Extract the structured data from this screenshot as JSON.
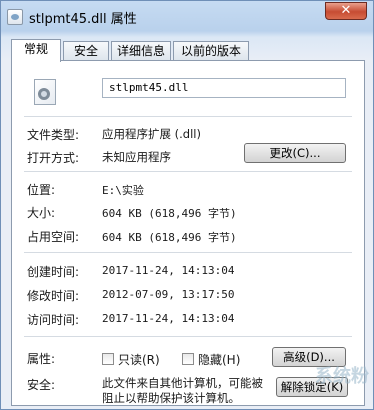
{
  "window": {
    "title": "stlpmt45.dll 属性",
    "close_glyph": "✕"
  },
  "tabs": [
    {
      "label": "常规",
      "active": true
    },
    {
      "label": "安全",
      "active": false
    },
    {
      "label": "详细信息",
      "active": false
    },
    {
      "label": "以前的版本",
      "active": false
    }
  ],
  "general": {
    "file_name": "stlpmt45.dll",
    "file_type_label": "文件类型:",
    "file_type_value": "应用程序扩展 (.dll)",
    "opens_with_label": "打开方式:",
    "opens_with_value": "未知应用程序",
    "change_button": "更改(C)...",
    "location_label": "位置:",
    "location_value": "E:\\实验",
    "size_label": "大小:",
    "size_value": "604 KB (618,496 字节)",
    "size_on_disk_label": "占用空间:",
    "size_on_disk_value": "604 KB (618,496 字节)",
    "created_label": "创建时间:",
    "created_value": "2017-11-24, 14:13:04",
    "modified_label": "修改时间:",
    "modified_value": "2012-07-09, 13:17:50",
    "accessed_label": "访问时间:",
    "accessed_value": "2017-11-24, 14:13:04",
    "attributes_label": "属性:",
    "readonly_label": "只读(R)",
    "readonly_checked": false,
    "hidden_label": "隐藏(H)",
    "hidden_checked": false,
    "advanced_button": "高级(D)...",
    "security_label": "安全:",
    "security_text": "此文件来自其他计算机，可能被阻止以帮助保护该计算机。",
    "unblock_button": "解除锁定(K)"
  },
  "watermark_text": "系统粉"
}
